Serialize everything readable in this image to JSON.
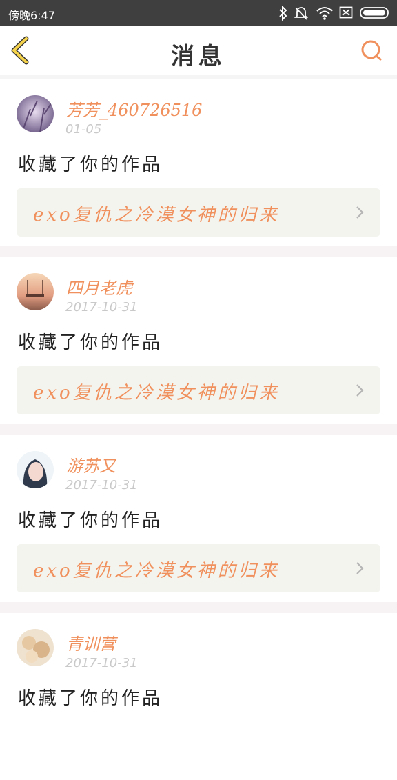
{
  "status_bar": {
    "time": "傍晚6:47",
    "icons": [
      "bluetooth-icon",
      "mute-icon",
      "wifi-icon",
      "sim-icon",
      "battery-icon"
    ]
  },
  "header": {
    "title": "消息",
    "back_icon": "chevron-left-icon",
    "search_icon": "search-icon"
  },
  "colors": {
    "accent": "#f0905c",
    "back_arrow": "#f5d34a",
    "status_bar": "#3f3f3f",
    "card_link_bg": "#f4f4ef"
  },
  "messages": [
    {
      "username": "芳芳_460726516",
      "date": "01-05",
      "action": "收藏了你的作品",
      "work_title": "exo复仇之冷漠女神的归来"
    },
    {
      "username": "四月老虎",
      "date": "2017-10-31",
      "action": "收藏了你的作品",
      "work_title": "exo复仇之冷漠女神的归来"
    },
    {
      "username": "游苏又",
      "date": "2017-10-31",
      "action": "收藏了你的作品",
      "work_title": "exo复仇之冷漠女神的归来"
    },
    {
      "username": "青训营",
      "date": "2017-10-31",
      "action": "收藏了你的作品",
      "work_title": ""
    }
  ]
}
